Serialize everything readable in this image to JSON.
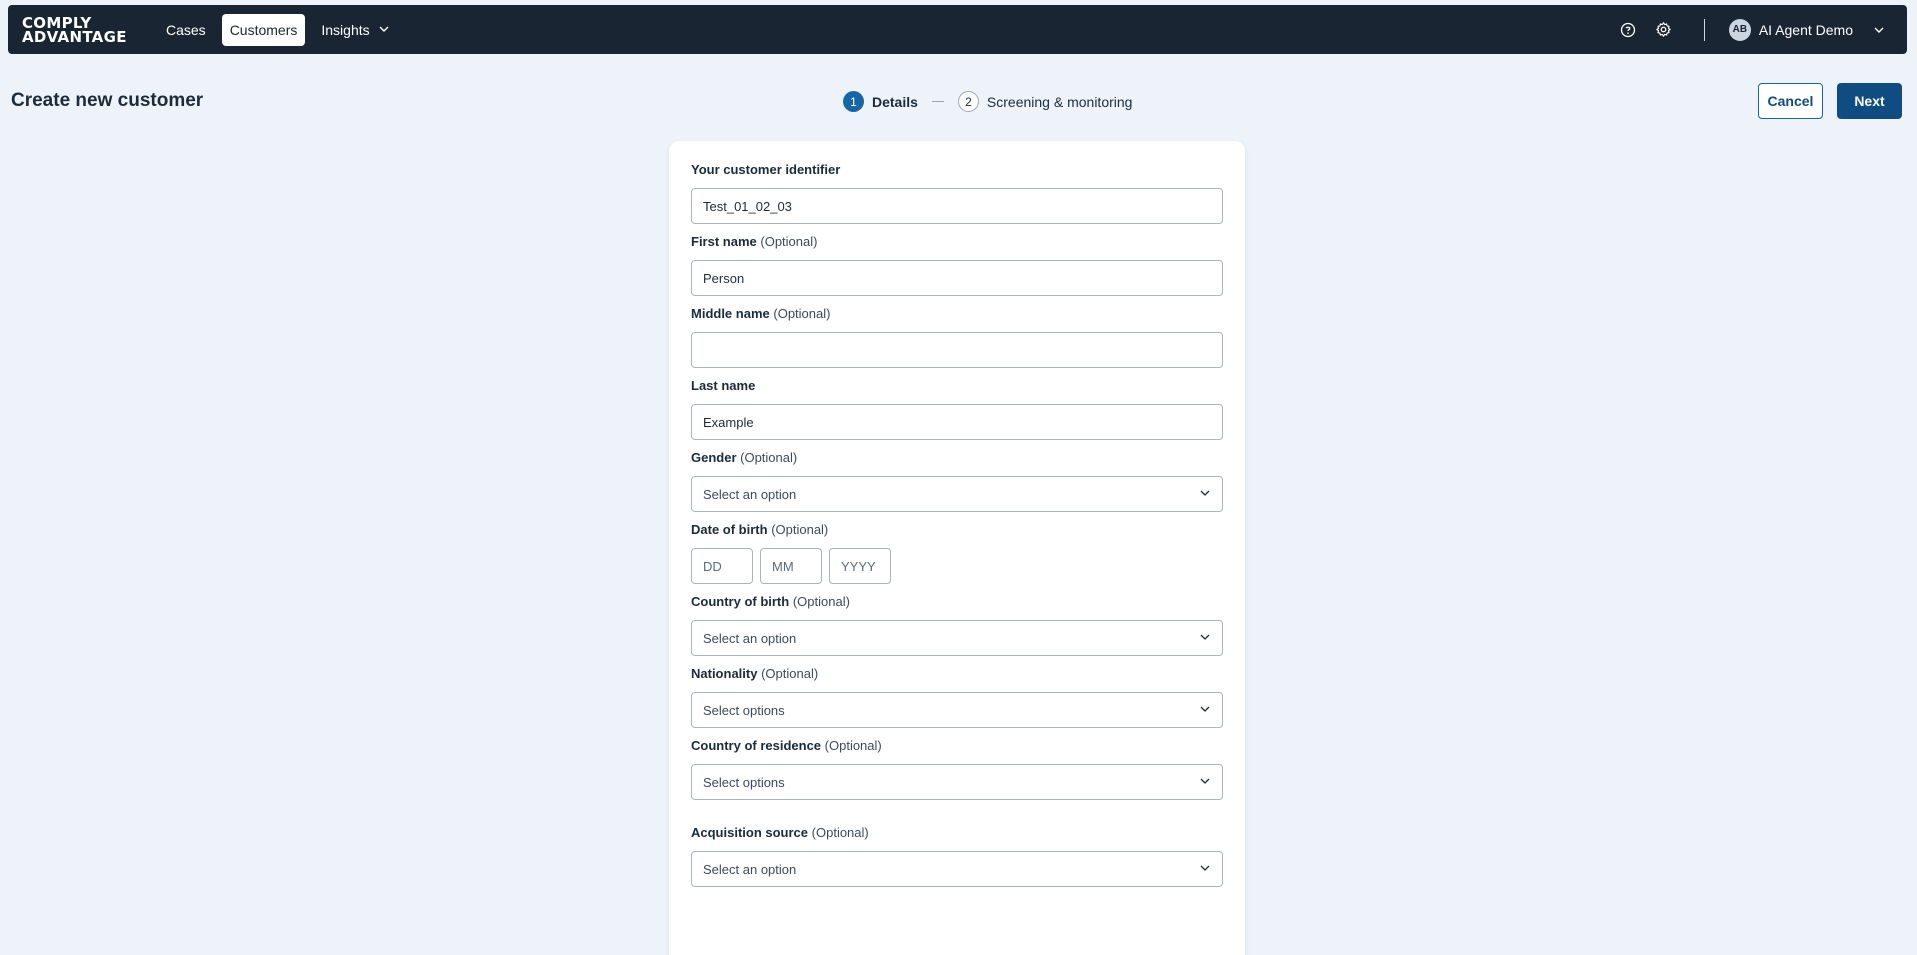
{
  "brand": {
    "line1": "COMPLY",
    "line2": "ADVANTAGE"
  },
  "nav": {
    "items": [
      {
        "label": "Cases"
      },
      {
        "label": "Customers"
      },
      {
        "label": "Insights"
      }
    ]
  },
  "user": {
    "initials": "AB",
    "name": "AI Agent Demo"
  },
  "page": {
    "title": "Create new customer"
  },
  "stepper": {
    "steps": [
      {
        "num": "1",
        "label": "Details"
      },
      {
        "num": "2",
        "label": "Screening & monitoring"
      }
    ]
  },
  "actions": {
    "cancel": "Cancel",
    "next": "Next"
  },
  "optional_tag": "(Optional)",
  "form": {
    "identifier": {
      "label": "Your customer identifier",
      "value": "Test_01_02_03"
    },
    "first_name": {
      "label": "First name",
      "value": "Person"
    },
    "middle_name": {
      "label": "Middle name",
      "value": ""
    },
    "last_name": {
      "label": "Last name",
      "value": "Example"
    },
    "gender": {
      "label": "Gender",
      "placeholder": "Select an option"
    },
    "dob": {
      "label": "Date of birth",
      "dd": "DD",
      "mm": "MM",
      "yyyy": "YYYY"
    },
    "country_of_birth": {
      "label": "Country of birth",
      "placeholder": "Select an option"
    },
    "nationality": {
      "label": "Nationality",
      "placeholder": "Select options"
    },
    "country_of_residence": {
      "label": "Country of residence",
      "placeholder": "Select options"
    },
    "acquisition_source": {
      "label": "Acquisition source",
      "placeholder": "Select an option"
    }
  },
  "colors": {
    "accent": "#0f4c81",
    "nav_bg": "#1a2533",
    "page_bg": "#edf3f9"
  }
}
